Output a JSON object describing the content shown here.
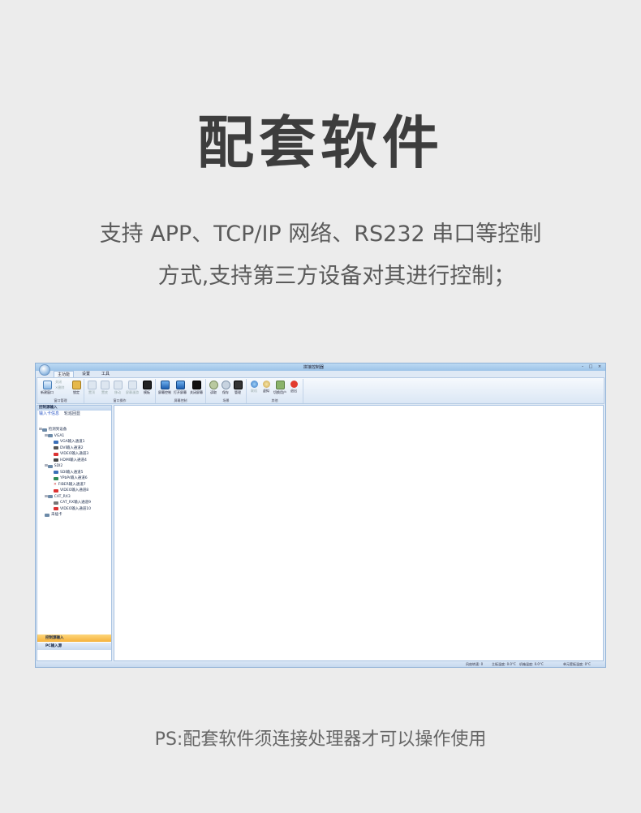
{
  "page": {
    "title": "配套软件",
    "desc_line1": "支持 APP、TCP/IP 网络、RS232 串口等控制",
    "desc_line2": "方式,支持第三方设备对其进行控制；",
    "ps": "PS:配套软件须连接处理器才可以操作使用"
  },
  "app": {
    "window_title": "拼接控制器",
    "tabs": [
      "主功能",
      "设置",
      "工具"
    ],
    "ribbon_groups": [
      {
        "label": "窗口管理",
        "buttons": [
          "新建窗口",
          "关闭",
          "删除",
          "锁定"
        ]
      },
      {
        "label": "窗口操作",
        "buttons": [
          "置顶",
          "置底",
          "移动",
          "屏幕漫游",
          "模板"
        ]
      },
      {
        "label": "屏幕控制",
        "buttons": [
          "屏幕控制",
          "打开屏幕",
          "关闭屏幕"
        ]
      },
      {
        "label": "场景",
        "buttons": [
          "读取",
          "保存",
          "管理"
        ]
      },
      {
        "label": "其他",
        "buttons": [
          "联机",
          "虚拟",
          "切换用户",
          "退出"
        ]
      }
    ],
    "left_panel": {
      "header": "控制源输入",
      "subtabs": [
        "输入卡信息",
        "轮巡回显"
      ],
      "tree": [
        {
          "level": 0,
          "label": "检测到设备"
        },
        {
          "level": 1,
          "label": "VGA1"
        },
        {
          "level": 2,
          "label": "VGA输入通道1"
        },
        {
          "level": 2,
          "label": "DVI输入通道2"
        },
        {
          "level": 2,
          "label": "VIDEO输入通道3"
        },
        {
          "level": 2,
          "label": "HDMI输入通道4"
        },
        {
          "level": 1,
          "label": "SDI2"
        },
        {
          "level": 2,
          "label": "SDI输入通道5"
        },
        {
          "level": 2,
          "label": "YPbPr输入通道6"
        },
        {
          "level": 2,
          "label": "FIBER输入通道7"
        },
        {
          "level": 2,
          "label": "VIDEO输入通道8"
        },
        {
          "level": 1,
          "label": "CAT_RX3"
        },
        {
          "level": 2,
          "label": "CAT_RX输入通道9"
        },
        {
          "level": 2,
          "label": "VIDEO输入通道10"
        },
        {
          "level": 1,
          "label": "未插卡"
        }
      ],
      "bottom_active": "控制源输入",
      "bottom_other": "PC输入源"
    },
    "status": {
      "fan": "风扇转速: 0",
      "board_temp": "主板温度: 0.0°C",
      "case_temp": "机箱温度: 0.0°C",
      "unit_temp": "单元壁板温度: 0°C"
    }
  },
  "colors": {
    "accent_orange": "#f6b23b",
    "ribbon_blue": "#dbe7f5",
    "close_red": "#e23b2e"
  }
}
